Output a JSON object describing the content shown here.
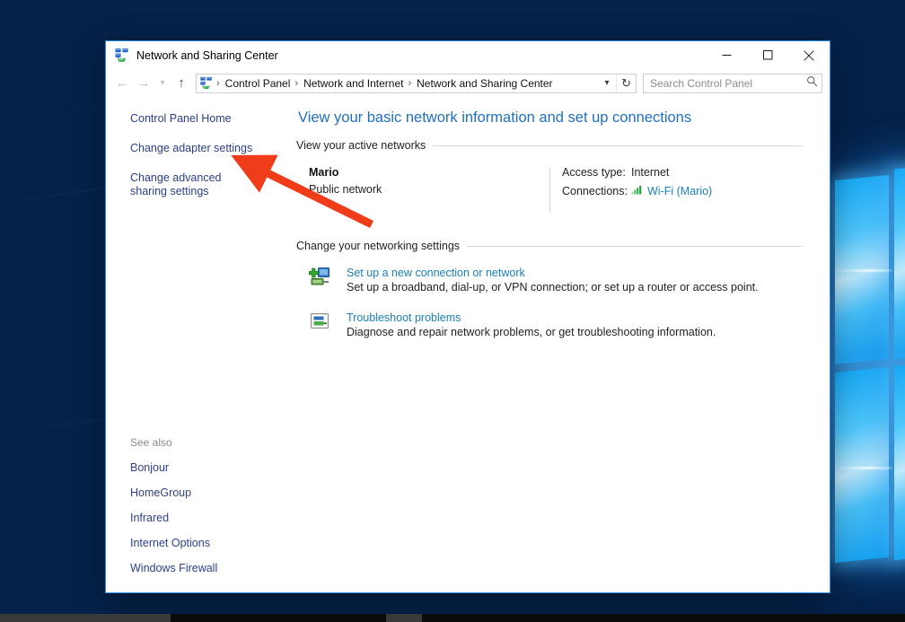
{
  "window": {
    "title": "Network and Sharing Center",
    "title_icon": "network-sharing-icon",
    "controls": {
      "minimize": "Minimize",
      "maximize": "Maximize",
      "close": "Close"
    }
  },
  "toolbar": {
    "back": "Back",
    "forward": "Forward",
    "recent": "Recent locations",
    "up": "Up one level",
    "breadcrumb_icon": "network-sharing-icon",
    "breadcrumbs": [
      "Control Panel",
      "Network and Internet",
      "Network and Sharing Center"
    ],
    "separator": "›",
    "dropdown": "Previous locations",
    "refresh": "Refresh"
  },
  "search": {
    "placeholder": "Search Control Panel",
    "value": "",
    "icon": "search-icon"
  },
  "sidebar": {
    "links": [
      {
        "label": "Control Panel Home",
        "name": "control-panel-home"
      },
      {
        "label": "Change adapter settings",
        "name": "change-adapter-settings"
      },
      {
        "label": "Change advanced sharing settings",
        "name": "change-advanced-sharing-settings"
      }
    ],
    "see_also": {
      "title": "See also",
      "links": [
        {
          "label": "Bonjour",
          "name": "bonjour"
        },
        {
          "label": "HomeGroup",
          "name": "homegroup"
        },
        {
          "label": "Infrared",
          "name": "infrared"
        },
        {
          "label": "Internet Options",
          "name": "internet-options"
        },
        {
          "label": "Windows Firewall",
          "name": "windows-firewall"
        }
      ]
    }
  },
  "main": {
    "heading": "View your basic network information and set up connections",
    "active_networks": {
      "section_title": "View your active networks",
      "network_name": "Mario",
      "network_type": "Public network",
      "access_type_label": "Access type:",
      "access_type_value": "Internet",
      "connections_label": "Connections:",
      "connections_value": "Wi-Fi (Mario)",
      "connections_icon": "wifi-signal-icon"
    },
    "networking_settings": {
      "section_title": "Change your networking settings",
      "items": [
        {
          "icon": "new-connection-icon",
          "title": "Set up a new connection or network",
          "description": "Set up a broadband, dial-up, or VPN connection; or set up a router or access point.",
          "name": "set-up-new-connection"
        },
        {
          "icon": "troubleshoot-icon",
          "title": "Troubleshoot problems",
          "description": "Diagnose and repair network problems, or get troubleshooting information.",
          "name": "troubleshoot-problems"
        }
      ]
    }
  },
  "annotation": {
    "type": "arrow",
    "color": "#F03C18",
    "points_to": "change-advanced-sharing-settings"
  },
  "colors": {
    "link": "#2b3f8c",
    "content_link": "#1a7fbd",
    "heading": "#1f6fc4",
    "window_border": "#2d8ce0",
    "annotation": "#F03C18"
  }
}
